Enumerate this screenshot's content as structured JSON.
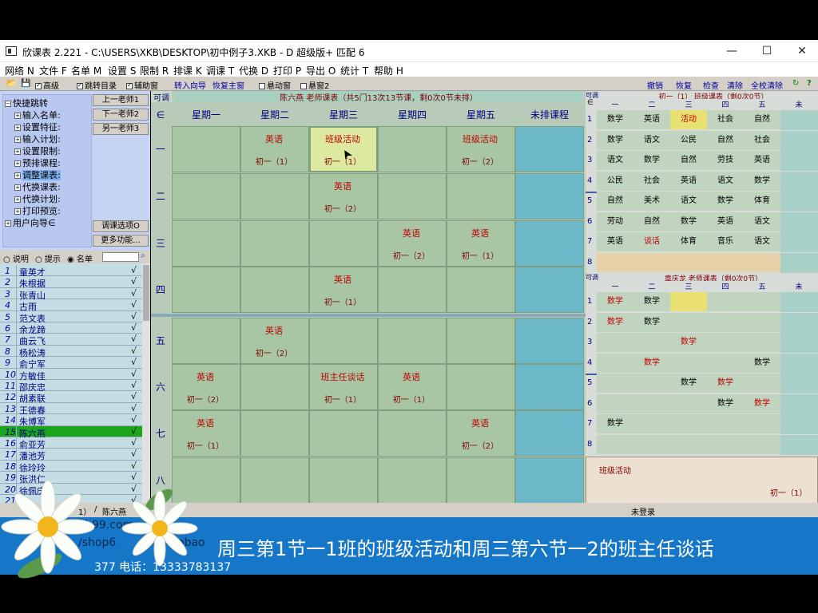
{
  "window": {
    "title": "欣课表 2.221 - C:\\USERS\\XKB\\DESKTOP\\初中例子3.XKB - D 超级版+ 匹配 6",
    "minimize": "—",
    "maximize": "☐",
    "close": "✕"
  },
  "menu": [
    "网络 N",
    "文件 F",
    "名单 M",
    "设置 S",
    "限制 R",
    "排课 K",
    "调课 T",
    "代换 D",
    "打印 P",
    "导出 O",
    "统计 T",
    "帮助 H"
  ],
  "toolbar": {
    "advanced": "高级",
    "jump_dir": "跳转目录",
    "aux_window": "辅助窗",
    "import_wizard": "转入向导",
    "restore_main": "恢复主窗",
    "float_window": "悬动窗",
    "float_window2": "悬窗2",
    "undo": "撤销",
    "redo": "恢复",
    "check": "检查",
    "clear": "清除",
    "clear_all": "全校清除",
    "help_q": "?"
  },
  "quick_nav": {
    "title": "快捷跳转",
    "items": [
      "输入名单:",
      "设置特征:",
      "输入计划:",
      "设置限制:",
      "预排课程:",
      "调整课表:",
      "代换课表:",
      "代换计划:",
      "打印预览:",
      "用户向导∈"
    ],
    "selected_index": 5,
    "prev_teacher": "上一老师1",
    "next_teacher": "下一老师2",
    "other_teacher": "另一老师3",
    "adjust_options": "调课选项O",
    "more_functions": "更多功能..."
  },
  "list_mode": {
    "explain": "说明",
    "hint": "提示",
    "roster": "名单"
  },
  "teachers": [
    {
      "n": "1",
      "name": "童英才"
    },
    {
      "n": "2",
      "name": "朱根据"
    },
    {
      "n": "3",
      "name": "张青山"
    },
    {
      "n": "4",
      "name": "古雨"
    },
    {
      "n": "5",
      "name": "范文表"
    },
    {
      "n": "6",
      "name": "余龙蹄"
    },
    {
      "n": "7",
      "name": "曲云飞"
    },
    {
      "n": "8",
      "name": "杨松涛"
    },
    {
      "n": "9",
      "name": "俞宁军"
    },
    {
      "n": "10",
      "name": "方敏佳"
    },
    {
      "n": "11",
      "name": "邵庆忠"
    },
    {
      "n": "12",
      "name": "胡素联"
    },
    {
      "n": "13",
      "name": "王德春"
    },
    {
      "n": "14",
      "name": "朱博军"
    },
    {
      "n": "15",
      "name": "陈六燕"
    },
    {
      "n": "16",
      "name": "俞亚芳"
    },
    {
      "n": "17",
      "name": "潘池芳"
    },
    {
      "n": "18",
      "name": "徐玲玲"
    },
    {
      "n": "19",
      "name": "张洪仁"
    },
    {
      "n": "20",
      "name": "徐佩庆"
    },
    {
      "n": "21",
      "name": ""
    }
  ],
  "selected_teacher": 14,
  "check_mark": "√",
  "main": {
    "tab_label": "可调",
    "header": "陈六燕  老师课表（共5门13次13节课，剩0次0节未排）",
    "corner": "∈",
    "days": [
      "星期一",
      "星期二",
      "星期三",
      "星期四",
      "星期五",
      "未排课程"
    ],
    "periods": [
      "一",
      "二",
      "三",
      "四",
      "五",
      "六",
      "七",
      "八"
    ],
    "lessons": [
      {
        "p": 0,
        "d": 1,
        "subject": "英语",
        "cls": "初一（1）"
      },
      {
        "p": 0,
        "d": 2,
        "subject": "班级活动",
        "cls": "初一（1）"
      },
      {
        "p": 0,
        "d": 4,
        "subject": "班级活动",
        "cls": "初一（2）"
      },
      {
        "p": 1,
        "d": 2,
        "subject": "英语",
        "cls": "初一（2）"
      },
      {
        "p": 2,
        "d": 3,
        "subject": "英语",
        "cls": "初一（2）"
      },
      {
        "p": 2,
        "d": 4,
        "subject": "英语",
        "cls": "初一（1）"
      },
      {
        "p": 3,
        "d": 2,
        "subject": "英语",
        "cls": "初一（1）"
      },
      {
        "p": 4,
        "d": 1,
        "subject": "英语",
        "cls": "初一（2）"
      },
      {
        "p": 5,
        "d": 0,
        "subject": "英语",
        "cls": "初一（2）"
      },
      {
        "p": 5,
        "d": 2,
        "subject": "班主任谈话",
        "cls": "初一（1）"
      },
      {
        "p": 5,
        "d": 3,
        "subject": "英语",
        "cls": "初一（1）"
      },
      {
        "p": 6,
        "d": 0,
        "subject": "英语",
        "cls": "初一（1）"
      },
      {
        "p": 6,
        "d": 4,
        "subject": "英语",
        "cls": "初一（2）"
      }
    ]
  },
  "class_table": {
    "tab_label": "可调",
    "header": "初一（1） 班级课表（剩0次0节）",
    "corner": "∈",
    "cols": [
      "一",
      "二",
      "三",
      "四",
      "五",
      "未"
    ],
    "rows": [
      [
        "数学",
        "英语",
        "活动",
        "社会",
        "自然"
      ],
      [
        "数学",
        "语文",
        "公民",
        "自然",
        "社会"
      ],
      [
        "语文",
        "数学",
        "自然",
        "劳技",
        "英语"
      ],
      [
        "公民",
        "社会",
        "英语",
        "语文",
        "数学"
      ],
      [
        "自然",
        "美术",
        "语文",
        "数学",
        "体育"
      ],
      [
        "劳动",
        "自然",
        "数学",
        "英语",
        "语文"
      ],
      [
        "英语",
        "谈话",
        "体育",
        "音乐",
        "语文"
      ],
      [
        "",
        "",
        "",
        "",
        ""
      ]
    ]
  },
  "teacher_table": {
    "tab_label": "可调",
    "header": "章庆龙  老师课表（剩0次0节）",
    "cols": [
      "一",
      "二",
      "三",
      "四",
      "五",
      "未"
    ],
    "rows": [
      [
        "数学",
        "数学",
        "",
        "",
        ""
      ],
      [
        "数学",
        "数学",
        "",
        "",
        ""
      ],
      [
        "",
        "",
        "数学",
        "",
        ""
      ],
      [
        "",
        "数学",
        "",
        "",
        "数学"
      ],
      [
        "",
        "",
        "数学",
        "数学",
        ""
      ],
      [
        "",
        "",
        "",
        "数学",
        "数学"
      ],
      [
        "数学",
        "",
        "",
        "",
        ""
      ],
      [
        "",
        "",
        "",
        "",
        ""
      ]
    ]
  },
  "preview": {
    "subject": "班级活动",
    "cls": "初一（1）"
  },
  "status": {
    "tab1": "1）",
    "tab2": "陈六燕",
    "login": "未登录"
  },
  "banner": {
    "caption": "周三第1节一1班的班级活动和周三第六节一2的班主任谈话",
    "ghost1": "kb99.com",
    "ghost2": "/shop6",
    "ghost3": "obao",
    "ghost4": "377  电话：13333783137"
  },
  "colors": {
    "cell": "#a8c6a4",
    "unscheduled": "#6cb8c8",
    "selected_row": "#1aa51a",
    "banner": "#1677c8",
    "subject_red": "#c00000"
  }
}
